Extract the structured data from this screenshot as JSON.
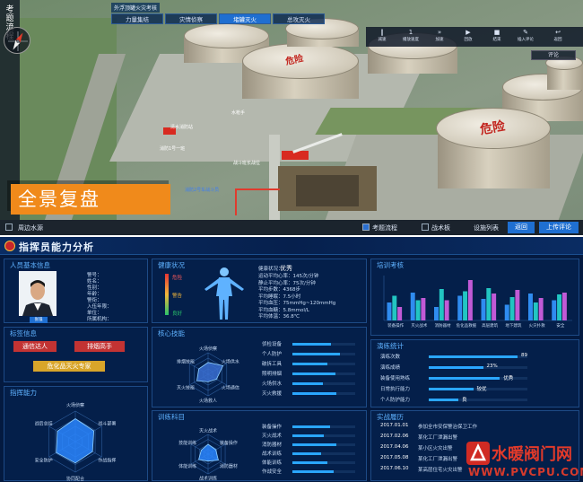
{
  "sim": {
    "sidebar_title": [
      "考",
      "题",
      "流",
      "程"
    ],
    "case_title": "外浮顶罐火灾考核",
    "tabs": [
      {
        "label": "力量集结",
        "active": false
      },
      {
        "label": "灾情侦察",
        "active": false
      },
      {
        "label": "堵罐灭火",
        "active": true
      },
      {
        "label": "总攻灭火",
        "active": false
      }
    ],
    "playbar": [
      {
        "icon": "‖",
        "label": "减速",
        "name": "slow-down-button"
      },
      {
        "icon": "1",
        "label": "播放速度",
        "name": "play-speed-display"
      },
      {
        "icon": "»",
        "label": "加速",
        "name": "speed-up-button"
      },
      {
        "icon": "▶",
        "label": "回放",
        "name": "replay-button"
      },
      {
        "icon": "■",
        "label": "结束",
        "name": "end-button"
      },
      {
        "icon": "✎",
        "label": "插入评论",
        "name": "insert-comment-button"
      },
      {
        "icon": "↩",
        "label": "返回",
        "name": "back-button"
      }
    ],
    "review_button": "评论",
    "panorama": "全景复盘",
    "tank_mark": "危险",
    "map_labels": [
      "清水消防站",
      "消防1号一班",
      "战斗班长战位",
      "消防2号车战斗员",
      "水枪手"
    ],
    "bottom": {
      "left_item": "周边水源",
      "process_check": "考题流程",
      "board_check": "战术板",
      "device_list": "设施列表",
      "return_btn": "返回",
      "upload_btn": "上传评论"
    }
  },
  "dash": {
    "title": "指挥员能力分析",
    "basic": {
      "title": "人员基本信息",
      "fields": [
        {
          "label": "警号：",
          "value": ""
        },
        {
          "label": "姓名：",
          "value": ""
        },
        {
          "label": "性别：",
          "value": ""
        },
        {
          "label": "年龄：",
          "value": ""
        },
        {
          "label": "警衔：",
          "value": ""
        },
        {
          "label": "入伍年限：",
          "value": ""
        },
        {
          "label": "单位：",
          "value": ""
        },
        {
          "label": "所属机构：",
          "value": ""
        }
      ],
      "name_tag": "张强"
    },
    "tags_panel": {
      "title": "标签信息",
      "tags": [
        "通信达人",
        "排烟高手",
        "危化品灭火专家"
      ]
    },
    "health": {
      "title": "健康状况",
      "legend": [
        "危险",
        "警告",
        "良好"
      ],
      "status_label": "健康状况：",
      "status_value": "优秀",
      "lines": [
        "运动平均心率：145次/分钟",
        "静止平均心率：75次/分钟",
        "平均步数：4368步",
        "平均睡眠：7.5小时",
        "平均血压：75mmHg~120mmHg",
        "平均血糖：5.8mmol/L",
        "平均体温：36.8℃"
      ]
    },
    "training": {
      "title": "培训考核",
      "categories": [
        "装备操作",
        "灭火战术",
        "消防器材",
        "危化品救援",
        "高层建筑",
        "地下建筑",
        "火灾扑救",
        "安全"
      ],
      "series": [
        {
          "values": [
            40,
            62,
            30,
            55,
            48,
            35,
            60,
            45
          ],
          "color": "#2f8cf0"
        },
        {
          "values": [
            55,
            45,
            70,
            65,
            72,
            52,
            40,
            58
          ],
          "color": "#22c5c2"
        },
        {
          "values": [
            30,
            50,
            45,
            90,
            60,
            68,
            50,
            62
          ],
          "color": "#c15ad6"
        }
      ],
      "ylim": [
        0,
        100
      ]
    },
    "core": {
      "title": "核心技能",
      "axes": [
        "火场侦察",
        "火场供水",
        "火场通信",
        "火场救人",
        "灭火技能",
        "排烟技能"
      ],
      "values": [
        0.55,
        0.8,
        0.45,
        0.35,
        0.6,
        0.5
      ],
      "skill_rows": [
        "侦检设备",
        "个人防护",
        "破拆工具",
        "照明排烟",
        "火场供水",
        "灭火救援"
      ],
      "skill_levels": [
        0.62,
        0.75,
        0.55,
        0.68,
        0.48,
        0.7
      ]
    },
    "drill_stats": {
      "title": "演练统计",
      "rows": [
        {
          "label": "演练次数",
          "value": "89",
          "level": 0.9
        },
        {
          "label": "演练成绩",
          "value": "23%",
          "level": 0.55
        },
        {
          "label": "装备使用熟练",
          "value": "优秀",
          "level": 0.72
        },
        {
          "label": "日常执行能力",
          "value": "较优",
          "level": 0.45
        },
        {
          "label": "个人防护能力",
          "value": "良",
          "level": 0.3
        }
      ]
    },
    "command": {
      "title": "指挥能力",
      "axes": [
        "火场侦察",
        "战斗部署",
        "作战指挥",
        "协同配合",
        "安全防护",
        "战后总结"
      ],
      "values": [
        0.75,
        0.7,
        0.65,
        0.7,
        0.72,
        0.68
      ]
    },
    "subjects": {
      "title": "训练科目",
      "axes": [
        "灭火战术",
        "装备操作",
        "消防器材",
        "战术训练",
        "体能训练",
        "技能训练"
      ],
      "values": [
        0.5,
        0.45,
        0.6,
        0.35,
        0.55,
        0.4
      ],
      "rows": [
        "装备操作",
        "灭火战术",
        "消防器材",
        "战术训练",
        "体能训练",
        "作战安全"
      ],
      "levels": [
        0.6,
        0.5,
        0.7,
        0.45,
        0.55,
        0.65
      ]
    },
    "history": {
      "title": "实战履历",
      "items": [
        {
          "date": "2017.01.01",
          "text": "参加全市安保警治保卫工作"
        },
        {
          "date": "2017.02.06",
          "text": "某化工厂泄漏出警"
        },
        {
          "date": "2017.04.06",
          "text": "某小区火灾出警"
        },
        {
          "date": "2017.05.08",
          "text": "某化工厂泄漏出警"
        },
        {
          "date": "2017.06.10",
          "text": "某高层住宅火灾出警"
        }
      ]
    }
  },
  "watermark": {
    "name": "水暖阀门网",
    "url": "WWW.PVCPU.COM"
  }
}
